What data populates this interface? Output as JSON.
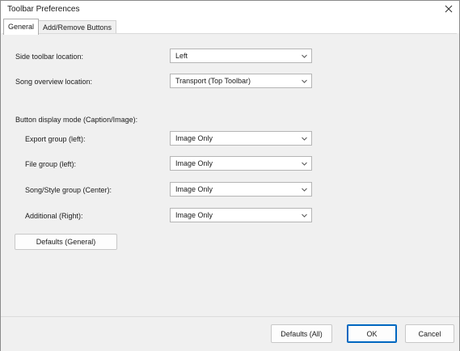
{
  "window": {
    "title": "Toolbar Preferences"
  },
  "tabs": [
    {
      "label": "General",
      "active": true
    },
    {
      "label": "Add/Remove Buttons",
      "active": false
    }
  ],
  "general": {
    "side_toolbar": {
      "label": "Side toolbar location:",
      "value": "Left"
    },
    "song_overview": {
      "label": "Song overview location:",
      "value": "Transport (Top Toolbar)"
    },
    "button_display_heading": "Button display mode (Caption/Image):",
    "groups": [
      {
        "label": "Export group (left):",
        "value": "Image Only"
      },
      {
        "label": "File group (left):",
        "value": "Image Only"
      },
      {
        "label": "Song/Style group (Center):",
        "value": "Image Only"
      },
      {
        "label": "Additional (Right):",
        "value": "Image Only"
      }
    ],
    "defaults_general_label": "Defaults (General)"
  },
  "footer": {
    "defaults_all_label": "Defaults (All)",
    "ok_label": "OK",
    "cancel_label": "Cancel"
  },
  "icons": {
    "close": "close-icon",
    "dropdown": "chevron-down-icon"
  }
}
